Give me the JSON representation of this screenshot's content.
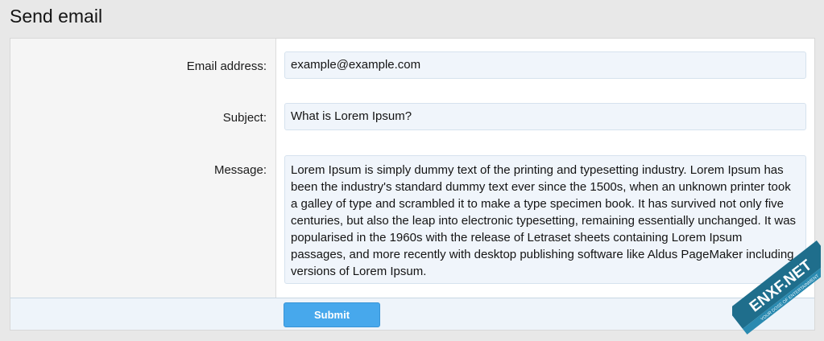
{
  "page": {
    "title": "Send email"
  },
  "form": {
    "email": {
      "label": "Email address:",
      "value": "example@example.com"
    },
    "subject": {
      "label": "Subject:",
      "value": "What is Lorem Ipsum?"
    },
    "message": {
      "label": "Message:",
      "value": "Lorem Ipsum is simply dummy text of the printing and typesetting industry. Lorem Ipsum has been the industry's standard dummy text ever since the 1500s, when an unknown printer took a galley of type and scrambled it to make a type specimen book. It has survived not only five centuries, but also the leap into electronic typesetting, remaining essentially unchanged. It was popularised in the 1960s with the release of Letraset sheets containing Lorem Ipsum passages, and more recently with desktop publishing software like Aldus PageMaker including versions of Lorem Ipsum."
    },
    "submit_label": "Submit"
  },
  "watermark": {
    "brand": "ENXF.NET",
    "tagline": "YOUR DOSE OF ENTERTAINMENT"
  },
  "colors": {
    "accent": "#47a8ec",
    "background": "#e8e8e8",
    "input_background": "#f0f5fb",
    "footer_background": "#eef4fa",
    "watermark_ribbon": "#1f6e8c"
  }
}
